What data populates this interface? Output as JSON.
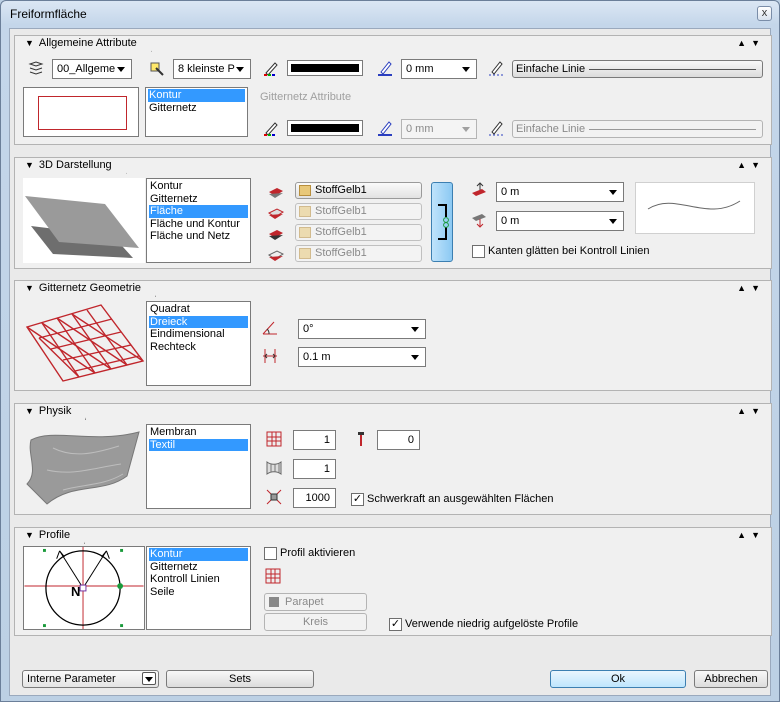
{
  "window": {
    "title": "Freiformfläche",
    "close_label": "x"
  },
  "icons": {
    "close": "close-icon",
    "layer": "layer-icon",
    "pen_color": "pen-color-icon",
    "pen_width": "pen-width-icon",
    "line_type": "line-type-icon",
    "material": "material-swatch-icon",
    "grid": "grid-icon"
  },
  "colors": {
    "selection": "#3399ff",
    "pen_color": "#000000",
    "window_frame": "#bcd0e4"
  },
  "allgemeine": {
    "title": "Allgemeine Attribute",
    "layer_value": "00_Allgeme",
    "pen_value": "8 kleinste P",
    "width_value": "0 mm",
    "linetype_value": "Einfache Linie",
    "list": [
      "Kontur",
      "Gitternetz"
    ],
    "list_selected": 0,
    "grid_attr_label": "Gitternetz Attribute",
    "grid_width_value": "0 mm",
    "grid_linetype_value": "Einfache Linie"
  },
  "darstellung": {
    "title": "3D Darstellung",
    "list": [
      "Kontur",
      "Gitternetz",
      "Fläche",
      "Fläche und Kontur",
      "Fläche und Netz"
    ],
    "list_selected": 2,
    "materials": [
      "StoffGelb1",
      "StoffGelb1",
      "StoffGelb1",
      "StoffGelb1"
    ],
    "offset_top": "0 m",
    "offset_bottom": "0 m",
    "smooth_label": "Kanten glätten bei Kontroll Linien",
    "smooth_checked": false
  },
  "geometrie": {
    "title": "Gitternetz Geometrie",
    "list": [
      "Quadrat",
      "Dreieck",
      "Eindimensional",
      "Rechteck"
    ],
    "list_selected": 1,
    "angle_value": "0°",
    "spacing_value": "0.1 m"
  },
  "physik": {
    "title": "Physik",
    "list": [
      "Membran",
      "Textil"
    ],
    "list_selected": 1,
    "field1": "1",
    "field2": "0",
    "field3": "1",
    "field4": "1000",
    "gravity_label": "Schwerkraft an ausgewählten Flächen",
    "gravity_checked": true
  },
  "profile": {
    "title": "Profile",
    "list": [
      "Kontur",
      "Gitternetz",
      "Kontroll Linien",
      "Seile"
    ],
    "list_selected": 0,
    "activate_label": "Profil aktivieren",
    "activate_checked": false,
    "parapet_label": "Parapet",
    "kreis_label": "Kreis",
    "lowres_label": "Verwende niedrig aufgelöste Profile",
    "lowres_checked": true,
    "compass_label": "N"
  },
  "footer": {
    "params_value": "Interne Parameter",
    "sets_label": "Sets",
    "ok_label": "Ok",
    "cancel_label": "Abbrechen"
  }
}
